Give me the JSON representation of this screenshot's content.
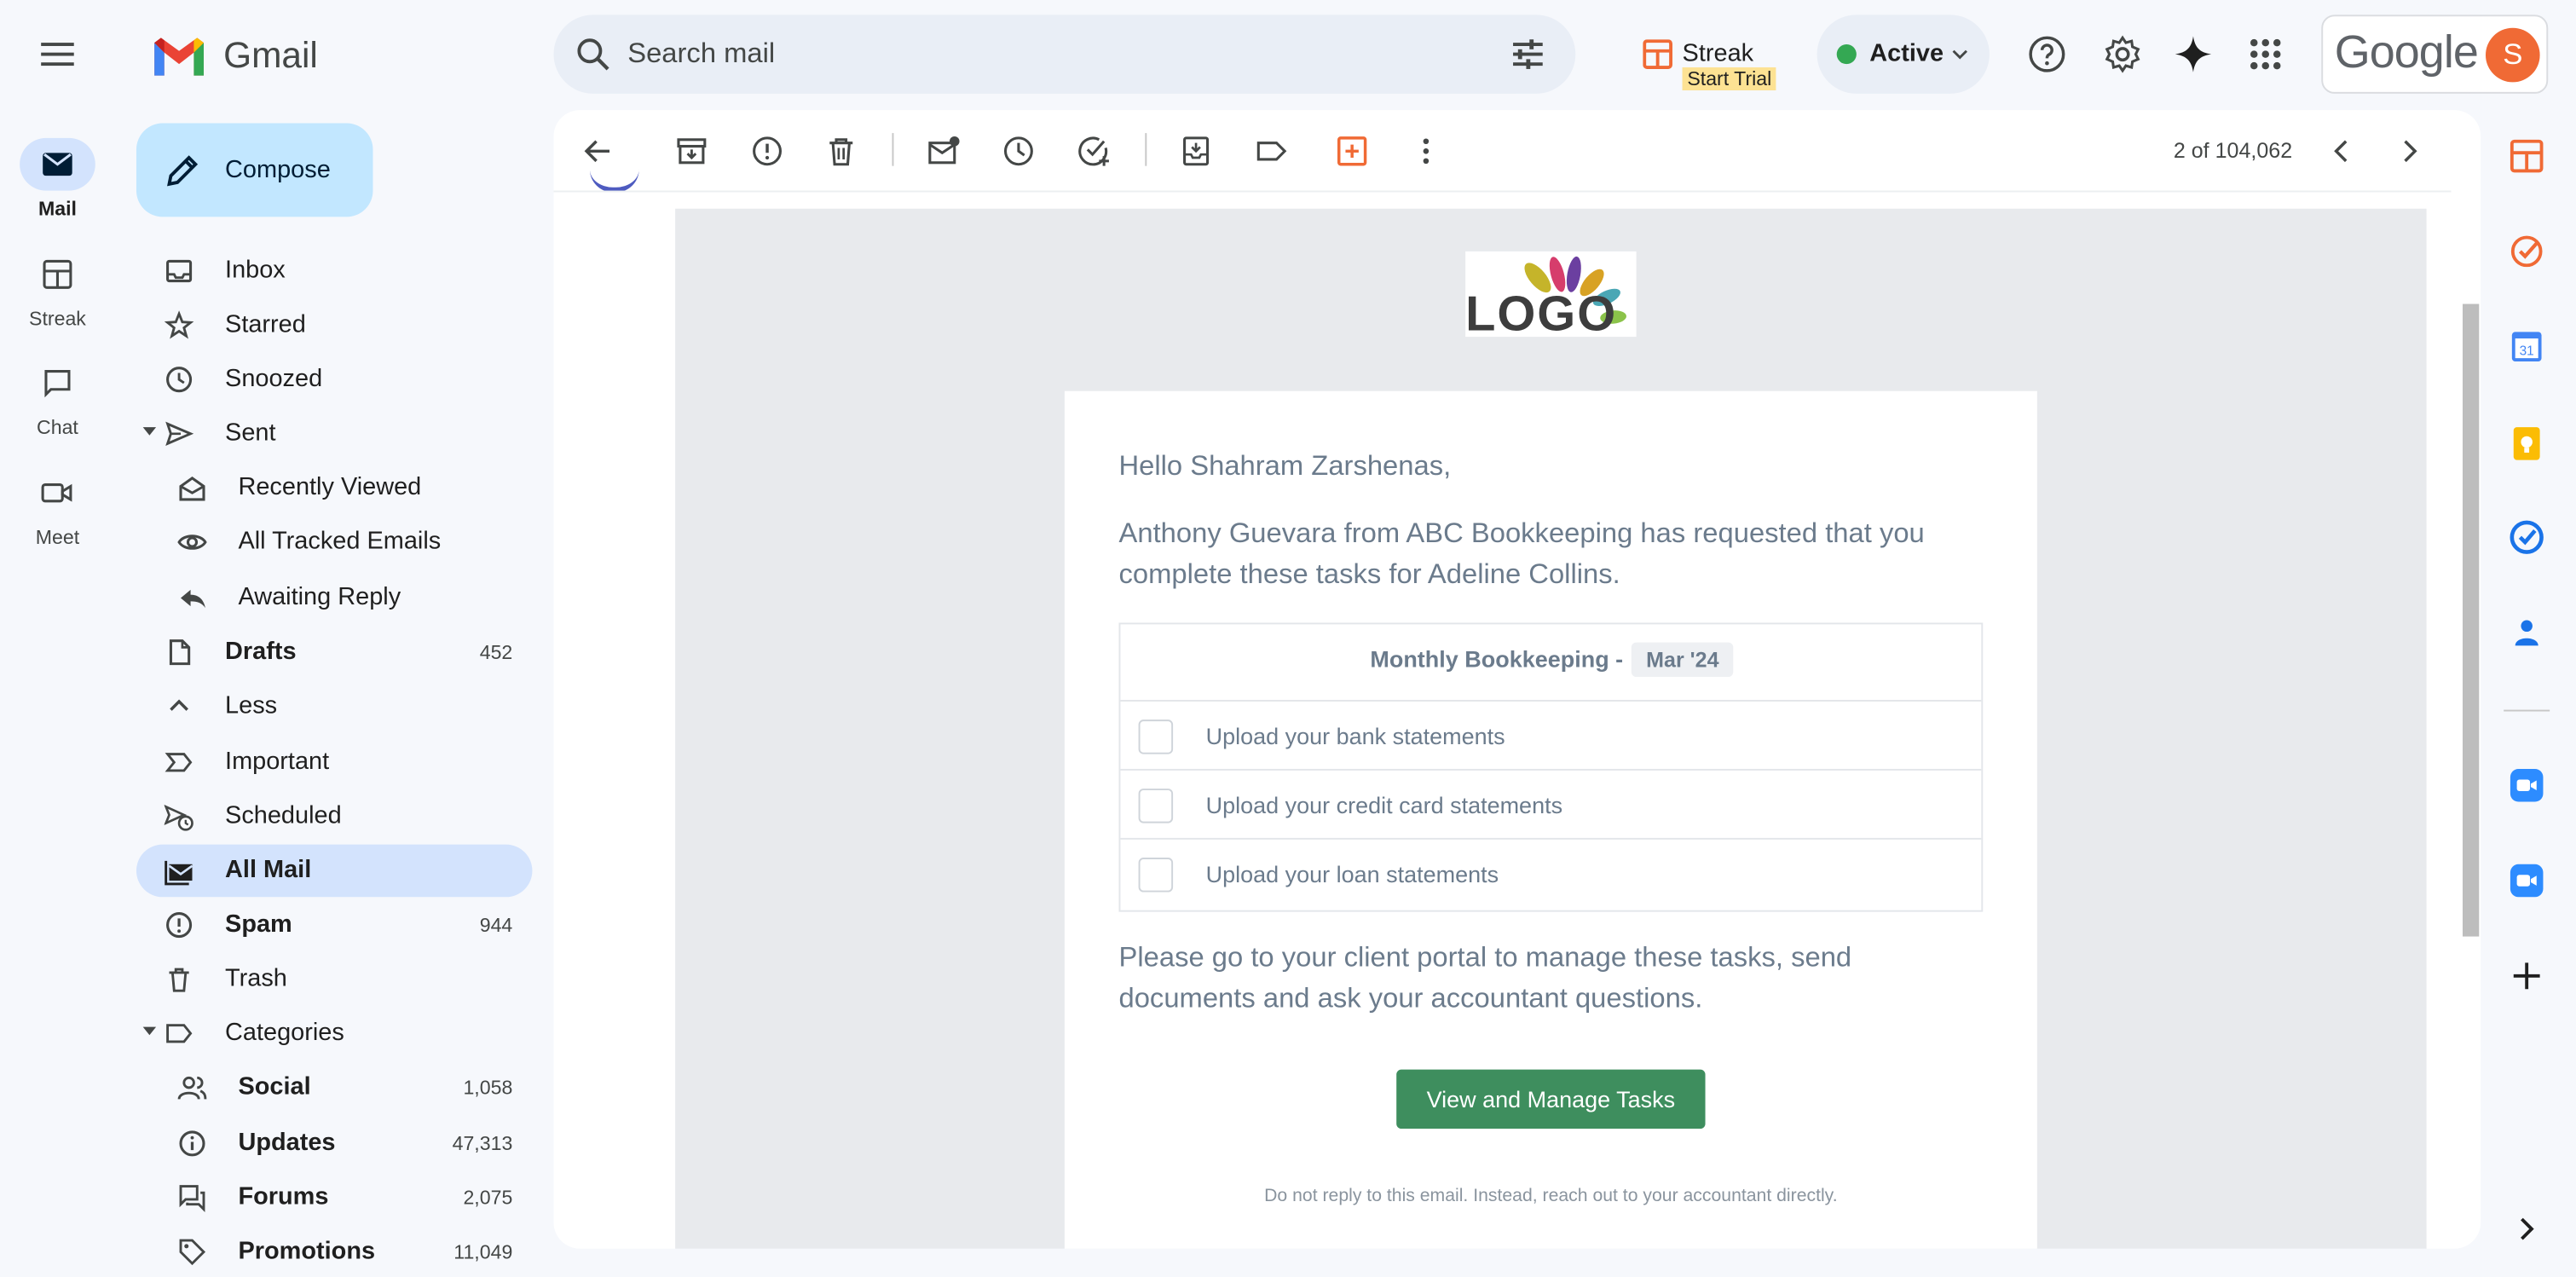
{
  "app": {
    "product_name": "Gmail",
    "brand_colors": {
      "red": "#ea4335",
      "blue": "#4285f4",
      "green": "#34a853",
      "yellow": "#fbbc04"
    }
  },
  "rail": {
    "items": [
      {
        "label": "Mail",
        "icon": "mail-icon",
        "active": true
      },
      {
        "label": "Streak",
        "icon": "streak-icon",
        "active": false
      },
      {
        "label": "Chat",
        "icon": "chat-icon",
        "active": false
      },
      {
        "label": "Meet",
        "icon": "meet-icon",
        "active": false
      }
    ]
  },
  "search": {
    "placeholder": "Search mail"
  },
  "header": {
    "streak_label": "Streak",
    "streak_trial": "Start Trial",
    "status_label": "Active",
    "account_brand": "Google",
    "avatar_initial": "S"
  },
  "compose": {
    "label": "Compose"
  },
  "nav": {
    "items": [
      {
        "label": "Inbox",
        "icon": "inbox-icon",
        "bold": false,
        "count": ""
      },
      {
        "label": "Starred",
        "icon": "star-icon",
        "bold": false,
        "count": ""
      },
      {
        "label": "Snoozed",
        "icon": "clock-icon",
        "bold": false,
        "count": ""
      },
      {
        "label": "Sent",
        "icon": "send-icon",
        "bold": false,
        "count": "",
        "expanded": true
      },
      {
        "label": "Recently Viewed",
        "icon": "envelope-open-icon",
        "bold": false,
        "count": "",
        "sub": true
      },
      {
        "label": "All Tracked Emails",
        "icon": "eye-icon",
        "bold": false,
        "count": "",
        "sub": true
      },
      {
        "label": "Awaiting Reply",
        "icon": "reply-icon",
        "bold": false,
        "count": "",
        "sub": true
      },
      {
        "label": "Drafts",
        "icon": "draft-icon",
        "bold": true,
        "count": "452"
      },
      {
        "label": "Less",
        "icon": "chevron-up-icon",
        "bold": false,
        "count": ""
      },
      {
        "label": "Important",
        "icon": "important-icon",
        "bold": false,
        "count": ""
      },
      {
        "label": "Scheduled",
        "icon": "scheduled-icon",
        "bold": false,
        "count": ""
      },
      {
        "label": "All Mail",
        "icon": "all-mail-icon",
        "bold": true,
        "count": "",
        "selected": true
      },
      {
        "label": "Spam",
        "icon": "spam-icon",
        "bold": true,
        "count": "944"
      },
      {
        "label": "Trash",
        "icon": "trash-icon",
        "bold": false,
        "count": ""
      },
      {
        "label": "Categories",
        "icon": "label-icon",
        "bold": false,
        "count": "",
        "expanded": true
      },
      {
        "label": "Social",
        "icon": "people-icon",
        "bold": true,
        "count": "1,058",
        "sub": true
      },
      {
        "label": "Updates",
        "icon": "info-icon",
        "bold": true,
        "count": "47,313",
        "sub": true
      },
      {
        "label": "Forums",
        "icon": "forum-icon",
        "bold": true,
        "count": "2,075",
        "sub": true
      },
      {
        "label": "Promotions",
        "icon": "tag-icon",
        "bold": true,
        "count": "11,049",
        "sub": true
      }
    ]
  },
  "toolbar": {
    "pager_text": "2 of 104,062"
  },
  "email": {
    "logo_text": "LOGO",
    "greeting": "Hello Shahram Zarshenas,",
    "intro_line1": "Anthony Guevara from ABC Bookkeeping has requested that you",
    "intro_line2": "complete these tasks for Adeline Collins.",
    "task_title": "Monthly Bookkeeping -",
    "task_period": "Mar '24",
    "tasks": [
      "Upload your bank statements",
      "Upload your credit card statements",
      "Upload your loan statements"
    ],
    "portal_line1": "Please go to your client portal to manage these tasks, send",
    "portal_line2": "documents and ask your accountant questions.",
    "cta_label": "View and Manage Tasks",
    "footnote": "Do not reply to this email. Instead, reach out to your accountant directly.",
    "cta_color": "#3e8e5e"
  }
}
